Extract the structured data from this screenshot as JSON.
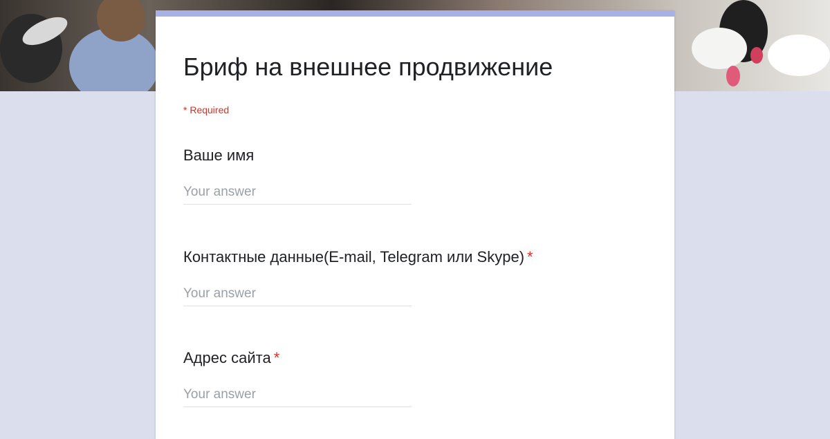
{
  "form": {
    "title": "Бриф на внешнее продвижение",
    "required_note": "* Required",
    "accent_color": "#a7b1e6",
    "required_color": "#d93025",
    "questions": [
      {
        "label": "Ваше имя",
        "required": false,
        "star": "",
        "placeholder": "Your answer"
      },
      {
        "label": "Контактные данные(E-mail, Telegram или Skype)",
        "required": true,
        "star": "*",
        "placeholder": "Your answer"
      },
      {
        "label": "Адрес сайта",
        "required": true,
        "star": "*",
        "placeholder": "Your answer"
      }
    ]
  },
  "banner": {
    "description_icon": "header-photo"
  }
}
